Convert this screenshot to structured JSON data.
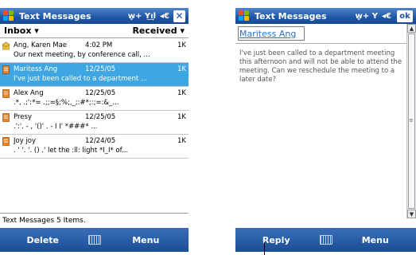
{
  "left": {
    "titlebar": {
      "title": "Text Messages",
      "signal": "ᴡ̥+ Y͢ıl",
      "sound": "◂€",
      "close": "✕"
    },
    "sortbar": {
      "folder": "Inbox ▾",
      "sort": "Received ▾"
    },
    "messages": [
      {
        "sender": "Ang, Karen Mae",
        "date": "4:02 PM",
        "size": "1K",
        "preview": "Our next meeting, by conference call, ..."
      },
      {
        "sender": "Maritess Ang",
        "date": "12/25/05",
        "size": "1K",
        "preview": "I've just been called to a department ..."
      },
      {
        "sender": "Alex Ang",
        "date": "12/25/05",
        "size": "1K",
        "preview": ".*,     .;':*=   .;;=§;%;,_;:#*;:;=:&_..."
      },
      {
        "sender": "Presy",
        "date": "12/25/05",
        "size": "1K",
        "preview": "  .':'.     - , '()' . -        I I'      *###* ..."
      },
      {
        "sender": "Joy joy",
        "date": "12/24/05",
        "size": "1K",
        "preview": ". ' '. '. () .'  let the  :ll:   light *I_I* of..."
      }
    ],
    "status": "Text Messages  5 Items.",
    "softkeys": {
      "left": "Delete",
      "right": "Menu"
    }
  },
  "right": {
    "titlebar": {
      "title": "Text Messages",
      "signal": "ᴡ̥+ Y",
      "sound": "◂€",
      "ok": "ok"
    },
    "subject": "Maritess Ang",
    "body": "I've just been called to a department meeting this afternoon and will not be able to attend the meeting. Can we reschedule the meeting to a later date?",
    "softkeys": {
      "left": "Reply",
      "right": "Menu"
    }
  },
  "colors": {
    "titlebar": "#1e56a6",
    "selection": "#3ea7e3",
    "envelope_unread": "#e8832a",
    "envelope_read": "#f0c040"
  },
  "icons": {
    "start": "windows-flag-icon",
    "message": "envelope-icon",
    "keyboard": "keyboard-icon"
  }
}
